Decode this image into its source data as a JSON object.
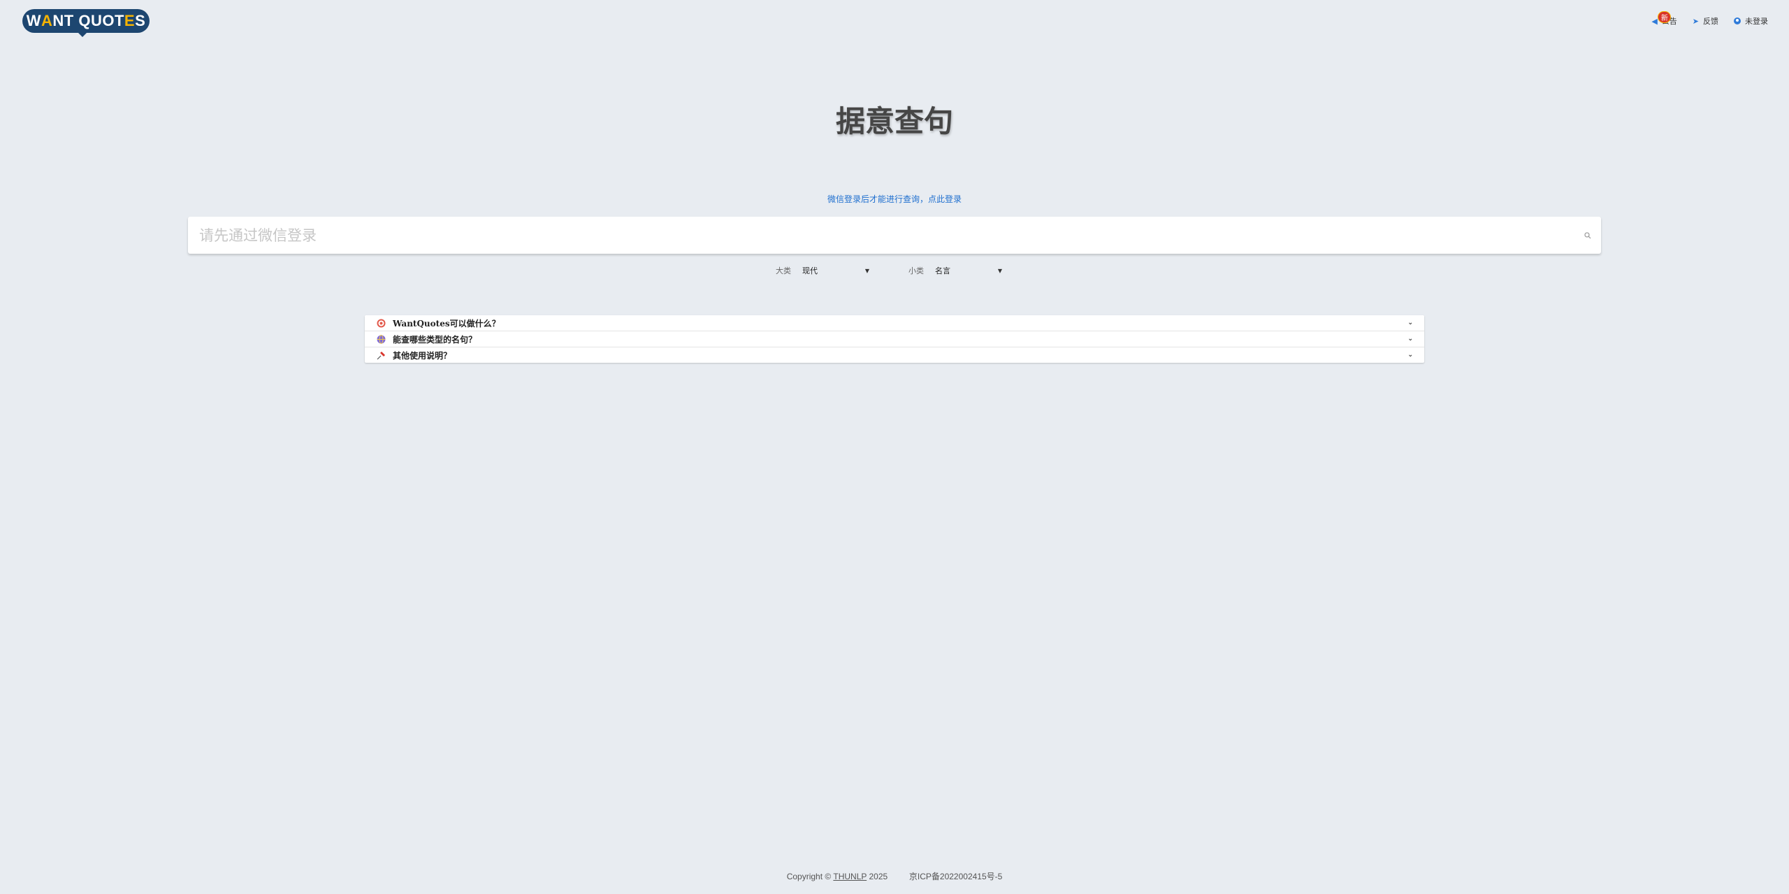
{
  "header": {
    "logo_text_1": "W",
    "logo_accent_1": "A",
    "logo_text_2": "NT QUOT",
    "logo_accent_2": "E",
    "logo_text_3": "S",
    "nav": {
      "announce_label": "公告",
      "announce_badge": "新",
      "feedback_label": "反馈",
      "user_label": "未登录"
    }
  },
  "main": {
    "title": "据意查句",
    "login_prompt": "微信登录后才能进行查询，点此登录",
    "search_placeholder": "请先通过微信登录"
  },
  "filters": {
    "major_label": "大类",
    "major_value": "现代",
    "minor_label": "小类",
    "minor_value": "名言"
  },
  "faq": [
    {
      "icon": "target-icon",
      "label": "WantQuotes可以做什么？"
    },
    {
      "icon": "globe-icon",
      "label": "能查哪些类型的名句？"
    },
    {
      "icon": "pin-icon",
      "label": "其他使用说明？"
    }
  ],
  "footer": {
    "copyright_prefix": "Copyright ©",
    "org": "THUNLP",
    "year": "2025",
    "icp": "京ICP备2022002415号-5"
  },
  "colors": {
    "background": "#e8ecf1",
    "logo": "#1d4670",
    "link": "#1f6fcf",
    "badge": "#d9342b"
  }
}
